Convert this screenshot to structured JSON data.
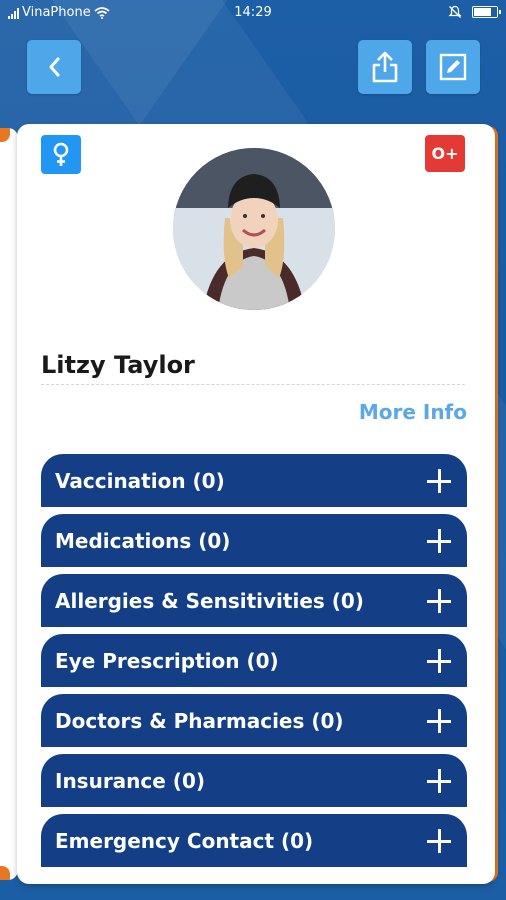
{
  "status_bar": {
    "carrier": "VinaPhone",
    "time": "14:29"
  },
  "profile": {
    "name": "Litzy Taylor",
    "blood_type": "O+",
    "gender_icon": "female-icon",
    "more_info_label": "More Info"
  },
  "sections": [
    {
      "label": "Vaccination (0)"
    },
    {
      "label": "Medications (0)"
    },
    {
      "label": "Allergies & Sensitivities (0)"
    },
    {
      "label": "Eye Prescription (0)"
    },
    {
      "label": "Doctors & Pharmacies (0)"
    },
    {
      "label": "Insurance (0)"
    },
    {
      "label": "Emergency Contact (0)"
    }
  ],
  "colors": {
    "background": "#1d5fa6",
    "section_bar": "#143f86",
    "accent": "#4ea7e8",
    "link": "#5aa9e6",
    "blood_badge": "#e53935",
    "gender_badge": "#2196f3",
    "card_edge": "#e87722"
  }
}
